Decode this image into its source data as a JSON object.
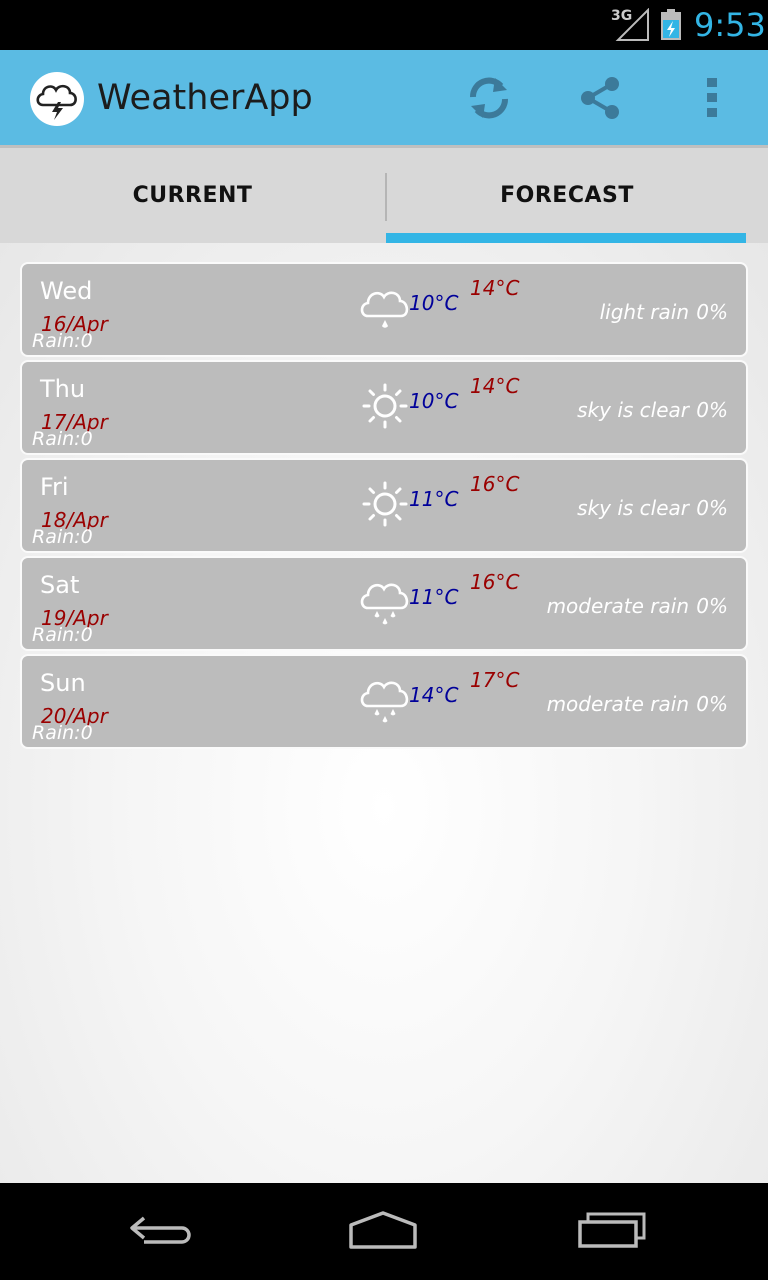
{
  "status_bar": {
    "network": "3G",
    "time": "9:53",
    "signal_icon": "signal-icon",
    "battery_icon": "battery-charging-icon",
    "accent_color": "#33b5e5"
  },
  "action_bar": {
    "title": "WeatherApp",
    "logo_icon": "storm-cloud-icon",
    "actions": [
      "refresh-icon",
      "share-icon",
      "overflow-menu-icon"
    ],
    "background_color": "#5bbbe3"
  },
  "tabs": [
    {
      "label": "CURRENT",
      "selected": false
    },
    {
      "label": "FORECAST",
      "selected": true
    }
  ],
  "forecast": [
    {
      "day": "Wed",
      "date": "16/Apr",
      "rain": "Rain:0",
      "icon": "rain-cloud-icon",
      "min": "10°C",
      "max": "14°C",
      "description": "light rain",
      "percent": "0%"
    },
    {
      "day": "Thu",
      "date": "17/Apr",
      "rain": "Rain:0",
      "icon": "sun-icon",
      "min": "10°C",
      "max": "14°C",
      "description": "sky is clear",
      "percent": "0%"
    },
    {
      "day": "Fri",
      "date": "18/Apr",
      "rain": "Rain:0",
      "icon": "sun-icon",
      "min": "11°C",
      "max": "16°C",
      "description": "sky is clear",
      "percent": "0%"
    },
    {
      "day": "Sat",
      "date": "19/Apr",
      "rain": "Rain:0",
      "icon": "heavy-rain-cloud-icon",
      "min": "11°C",
      "max": "16°C",
      "description": "moderate rain",
      "percent": "0%"
    },
    {
      "day": "Sun",
      "date": "20/Apr",
      "rain": "Rain:0",
      "icon": "heavy-rain-cloud-icon",
      "min": "14°C",
      "max": "17°C",
      "description": "moderate rain",
      "percent": "0%"
    }
  ],
  "colors": {
    "min_temp": "#00009a",
    "max_temp": "#9a0000",
    "row_background": "#bcbcbc"
  },
  "nav_bar": {
    "buttons": [
      "back-icon",
      "home-icon",
      "recents-icon"
    ]
  }
}
